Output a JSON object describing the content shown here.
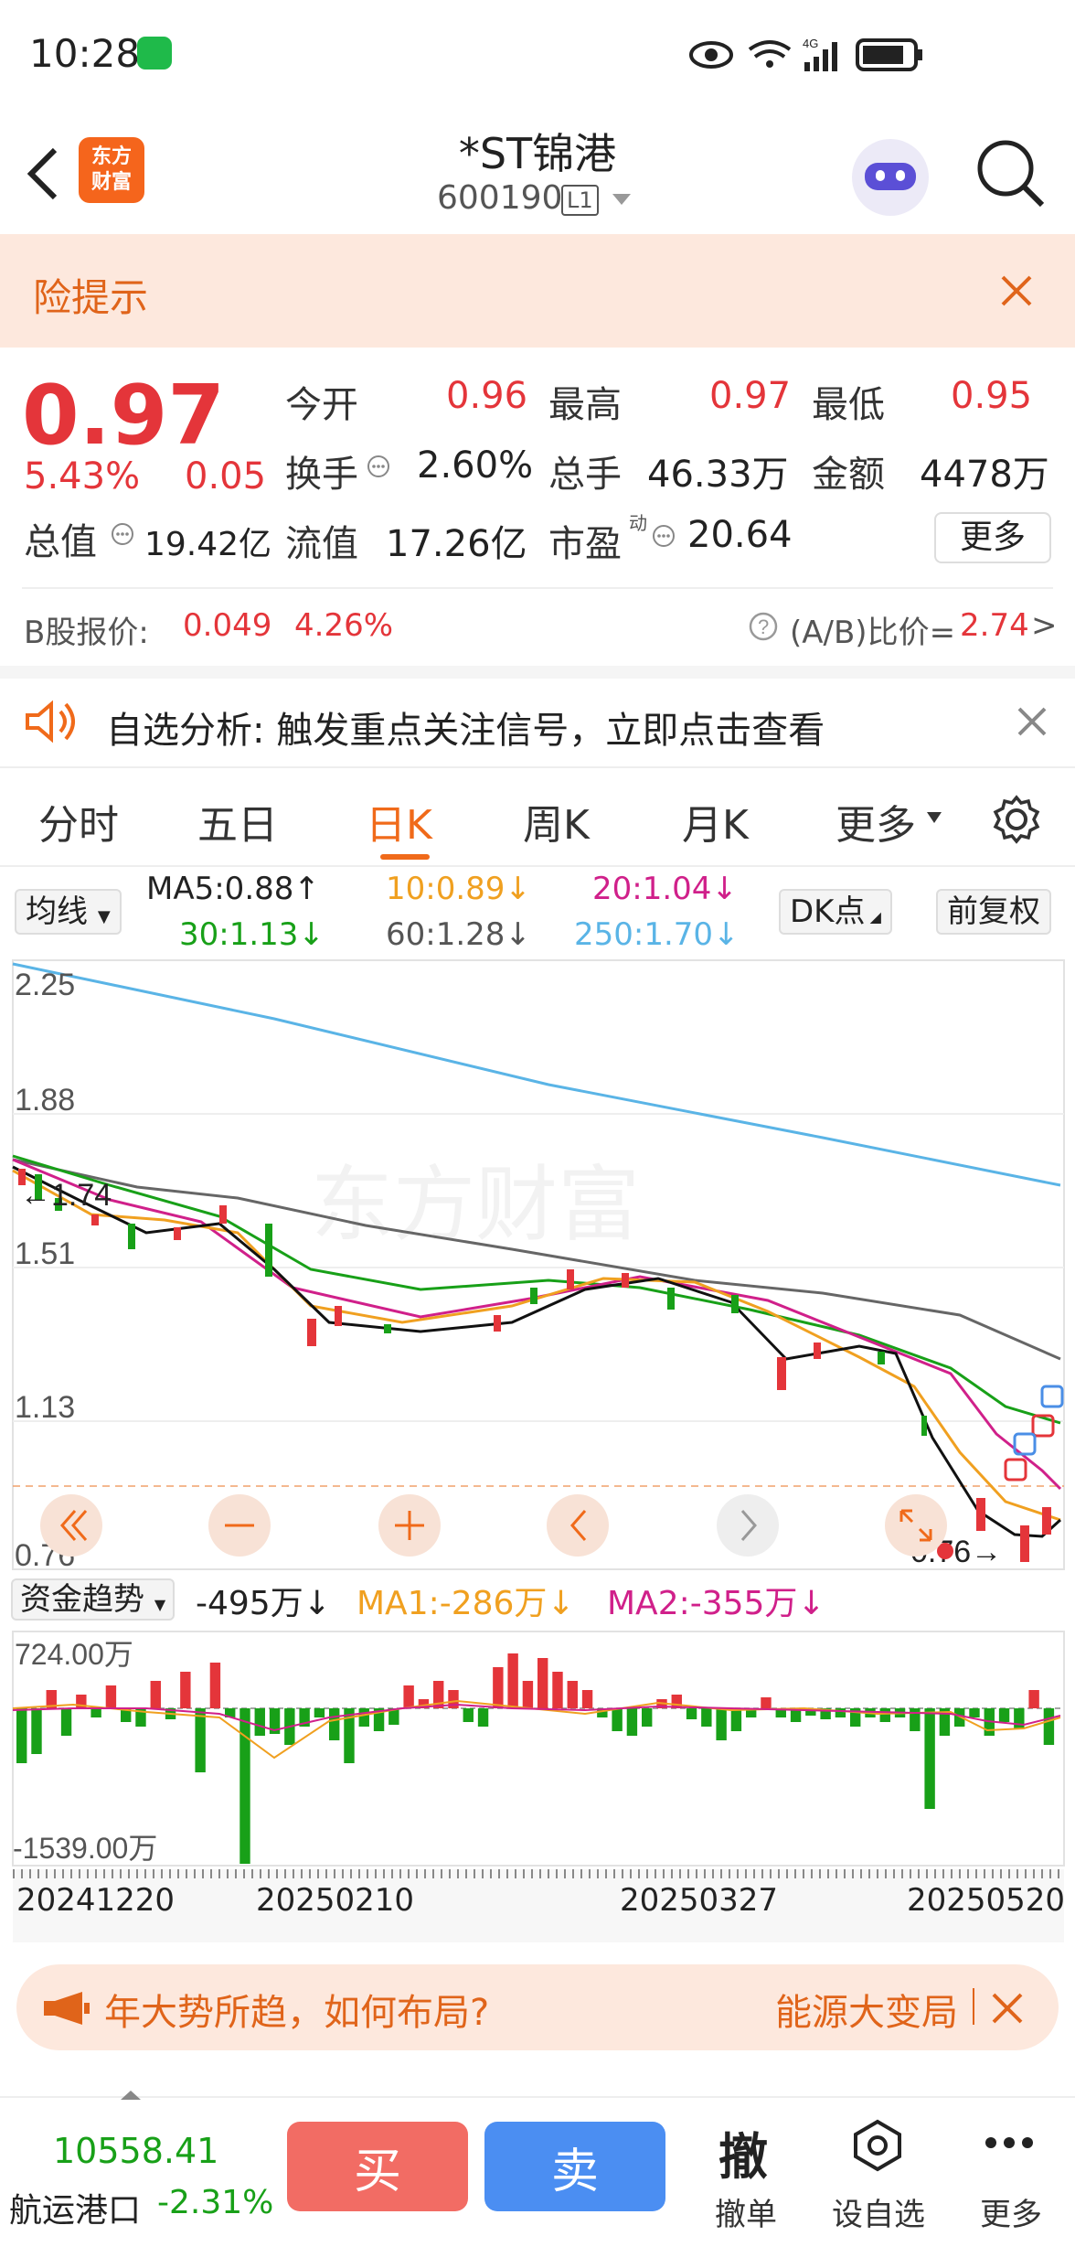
{
  "status": {
    "time": "10:28",
    "network": "4G"
  },
  "header": {
    "title": "*ST锦港",
    "code": "600190",
    "level": "L1",
    "logo_text1": "东方",
    "logo_text2": "财富"
  },
  "risk": {
    "text": "险提示"
  },
  "quote": {
    "price": "0.97",
    "change_pct": "5.43%",
    "change": "0.05",
    "open_label": "今开",
    "open": "0.96",
    "high_label": "最高",
    "high": "0.97",
    "low_label": "最低",
    "low": "0.95",
    "turnover_label": "换手",
    "turnover": "2.60%",
    "volume_label": "总手",
    "volume": "46.33万",
    "amount_label": "金额",
    "amount": "4478万",
    "mktcap_label": "总值",
    "mktcap": "19.42亿",
    "float_label": "流值",
    "float": "17.26亿",
    "pe_label": "市盈",
    "pe_sup": "动",
    "pe": "20.64",
    "more": "更多"
  },
  "bshare": {
    "label": "B股报价:",
    "price": "0.049",
    "pct": "4.26%",
    "ratio_label": "(A/B)比价=",
    "ratio": "2.74",
    "arrow": ">"
  },
  "analysis": {
    "text": "自选分析:  触发重点关注信号，立即点击查看"
  },
  "tabs": {
    "t1": "分时",
    "t2": "五日",
    "t3": "日K",
    "t4": "周K",
    "t5": "月K",
    "t6": "更多"
  },
  "ma": {
    "select": "均线",
    "ma5": "MA5:0.88",
    "ma10": "10:0.89",
    "ma20": "20:1.04",
    "ma30": "30:1.13",
    "ma60": "60:1.28",
    "ma250": "250:1.70",
    "dk": "DK点",
    "fq": "前复权",
    "up": "↑",
    "down": "↓"
  },
  "chart": {
    "y1": "2.25",
    "y2": "1.88",
    "y3": "1.51",
    "y4": "1.13",
    "y5": "0.76",
    "hi_label": "←1.74",
    "lo_label": "0.76→",
    "watermark": "东方财富"
  },
  "fund": {
    "select": "资金趋势",
    "val": "-495万",
    "ma1": "MA1:-286万",
    "ma2": "MA2:-355万",
    "top": "724.00万",
    "bottom": "-1539.00万",
    "down": "↓"
  },
  "dates": {
    "d1": "20241220",
    "d2": "20250210",
    "d3": "20250327",
    "d4": "20250520"
  },
  "banner": {
    "text1": "年大势所趋，如何布局?",
    "text2": "能源大变局"
  },
  "bottom": {
    "index_val": "10558.41",
    "index_name": "航运港口",
    "index_pct": "-2.31%",
    "buy": "买",
    "sell": "卖",
    "cancel_big": "撤",
    "cancel": "撤单",
    "watch": "设自选",
    "more": "更多"
  },
  "colors": {
    "up": "#e4353a",
    "down": "#18a018",
    "accent": "#f06a1a",
    "ma5": "#111111",
    "ma10": "#f0a020",
    "ma20": "#d0208a",
    "ma30": "#18a018",
    "ma60": "#666666",
    "ma250": "#5ab4e6"
  }
}
